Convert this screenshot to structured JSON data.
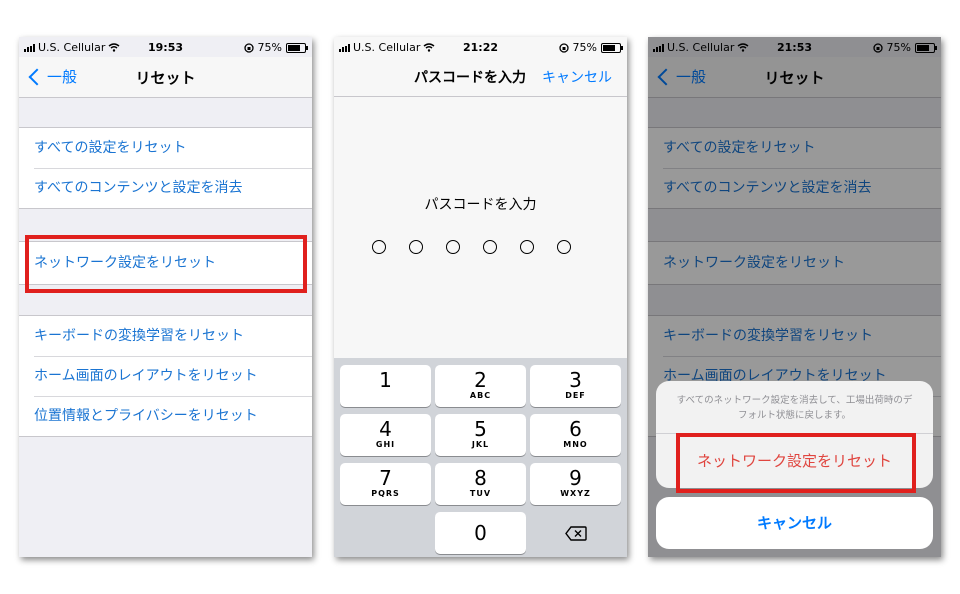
{
  "status_bars": [
    {
      "carrier": "U.S. Cellular",
      "time": "19:53",
      "battery": "75%",
      "battery_level": 0.75
    },
    {
      "carrier": "U.S. Cellular",
      "time": "21:22",
      "battery": "75%",
      "battery_level": 0.75
    },
    {
      "carrier": "U.S. Cellular",
      "time": "21:53",
      "battery": "75%",
      "battery_level": 0.75
    }
  ],
  "reset_screen": {
    "back_label": "一般",
    "title": "リセット",
    "items": [
      "すべての設定をリセット",
      "すべてのコンテンツと設定を消去",
      "ネットワーク設定をリセット",
      "キーボードの変換学習をリセット",
      "ホーム画面のレイアウトをリセット",
      "位置情報とプライバシーをリセット"
    ]
  },
  "passcode_screen": {
    "title": "パスコードを入力",
    "cancel_label": "キャンセル",
    "prompt": "パスコードを入力",
    "digit_count": 6,
    "keys": [
      {
        "num": "1",
        "letters": ""
      },
      {
        "num": "2",
        "letters": "ABC"
      },
      {
        "num": "3",
        "letters": "DEF"
      },
      {
        "num": "4",
        "letters": "GHI"
      },
      {
        "num": "5",
        "letters": "JKL"
      },
      {
        "num": "6",
        "letters": "MNO"
      },
      {
        "num": "7",
        "letters": "PQRS"
      },
      {
        "num": "8",
        "letters": "TUV"
      },
      {
        "num": "9",
        "letters": "WXYZ"
      },
      {
        "num": "0",
        "letters": ""
      }
    ]
  },
  "action_sheet": {
    "message": "すべてのネットワーク設定を消去して、工場出荷時のデフォルト状態に戻します。",
    "confirm_label": "ネットワーク設定をリセット",
    "cancel_label": "キャンセル"
  },
  "colors": {
    "link": "#007aff",
    "highlight": "#e0201d",
    "destructive": "#e0453f"
  },
  "icons": [
    "signal-bars-icon",
    "wifi-icon",
    "rotation-lock-icon",
    "battery-icon",
    "chevron-left-icon",
    "delete-backspace-icon"
  ]
}
